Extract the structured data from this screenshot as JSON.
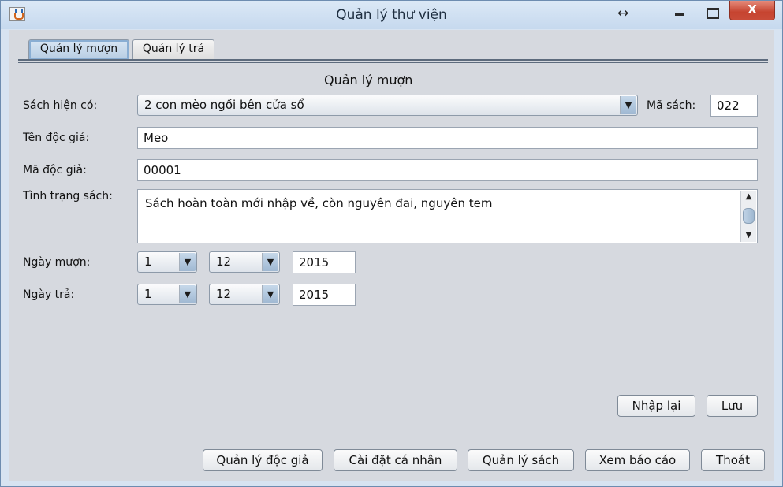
{
  "window": {
    "title": "Quản lý thư viện",
    "icons": {
      "app": "java-coffee-cup-icon",
      "resize": "double-arrow-icon",
      "minimize": "minimize-icon",
      "maximize": "maximize-icon",
      "close": "close-icon"
    },
    "resize_glyph": "↔",
    "close_glyph": "X"
  },
  "tabs": [
    {
      "label": "Quản lý mượn",
      "selected": true
    },
    {
      "label": "Quản lý trả",
      "selected": false
    }
  ],
  "form": {
    "title": "Quản lý mượn",
    "book_label": "Sách hiện có:",
    "book_selected": "2 con mèo ngồi bên cửa sổ",
    "book_code_label": "Mã sách:",
    "book_code_value": "022",
    "reader_name_label": "Tên độc giả:",
    "reader_name_value": "Meo",
    "reader_code_label": "Mã độc giả:",
    "reader_code_value": "00001",
    "book_condition_label": "Tình trạng sách:",
    "book_condition_value": "Sách hoàn toàn mới nhập về, còn nguyên đai, nguyên tem",
    "borrow_date_label": "Ngày mượn:",
    "borrow_day": "1",
    "borrow_month": "12",
    "borrow_year": "2015",
    "return_date_label": "Ngày trả:",
    "return_day": "1",
    "return_month": "12",
    "return_year": "2015",
    "dropdown_glyph": "▼",
    "scroll_up_glyph": "▲",
    "scroll_down_glyph": "▼"
  },
  "actions": {
    "reset": "Nhập lại",
    "save": "Lưu"
  },
  "bottom_buttons": {
    "readers": "Quản lý độc giả",
    "settings": "Cài đặt cá nhân",
    "books": "Quản lý sách",
    "reports": "Xem báo cáo",
    "exit": "Thoát"
  }
}
